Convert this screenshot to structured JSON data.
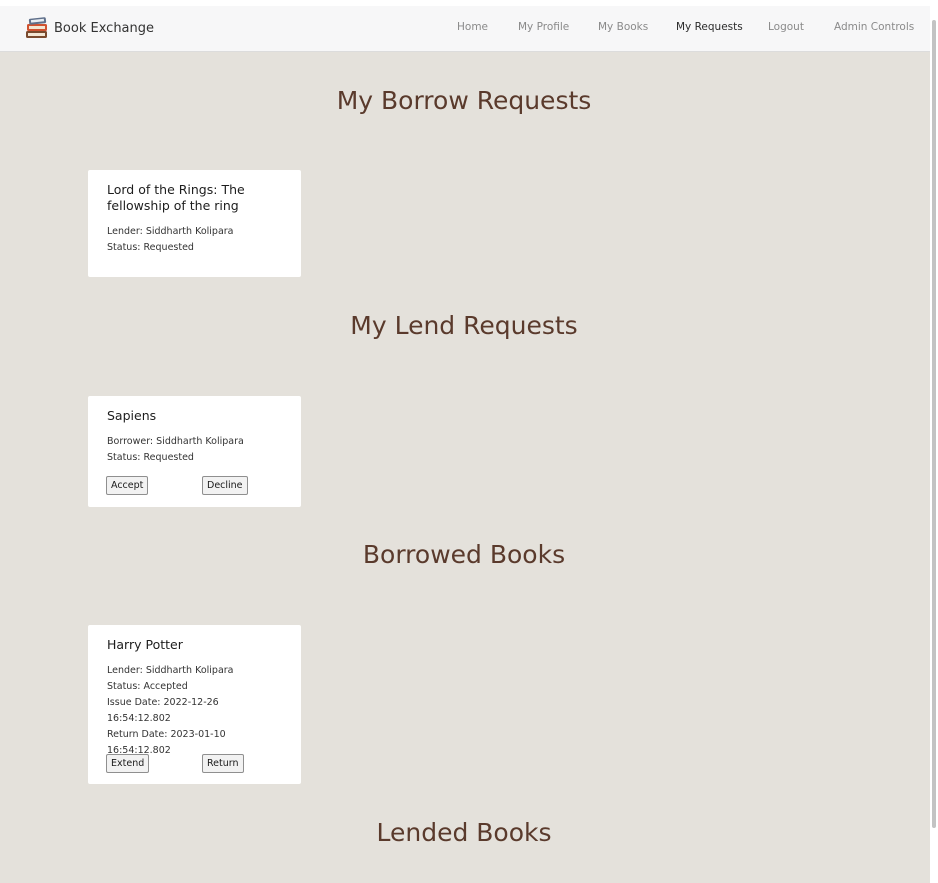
{
  "navbar": {
    "brand": "Book Exchange",
    "links": [
      "Home",
      "My Profile",
      "My Books",
      "My Requests",
      "Logout",
      "Admin Controls"
    ],
    "active": "My Requests"
  },
  "sections": {
    "borrow_requests": {
      "heading": "My Borrow Requests",
      "card": {
        "title": "Lord of the Rings: The fellowship of the ring",
        "lines": [
          "Lender: Siddharth Kolipara",
          "Status: Requested"
        ]
      }
    },
    "lend_requests": {
      "heading": "My Lend Requests",
      "card": {
        "title": "Sapiens",
        "lines": [
          "Borrower: Siddharth Kolipara",
          "Status: Requested"
        ],
        "buttons": [
          "Accept",
          "Decline"
        ]
      }
    },
    "borrowed_books": {
      "heading": "Borrowed Books",
      "card": {
        "title": "Harry Potter",
        "lines": [
          "Lender: Siddharth Kolipara",
          "Status: Accepted",
          "Issue Date: 2022-12-26 16:54:12.802",
          "Return Date: 2023-01-10 16:54:12.802"
        ],
        "buttons": [
          "Extend",
          "Return"
        ]
      }
    },
    "lended_books": {
      "heading": "Lended Books"
    }
  },
  "colors": {
    "page_background": "#e4e1db",
    "heading": "#5a3a2c",
    "navbar_background": "#f7f7f8"
  }
}
